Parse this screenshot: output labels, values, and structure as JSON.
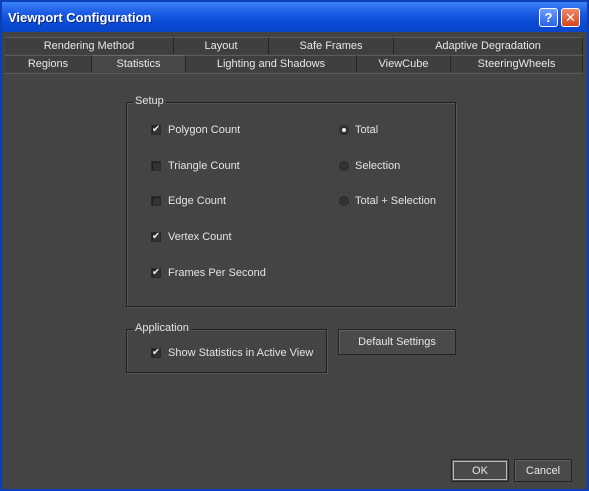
{
  "window": {
    "title": "Viewport Configuration",
    "help_glyph": "?",
    "close_glyph": "✕"
  },
  "tabs": {
    "row1": [
      "Rendering Method",
      "Layout",
      "Safe Frames",
      "Adaptive Degradation"
    ],
    "row2": [
      "Regions",
      "Statistics",
      "Lighting and Shadows",
      "ViewCube",
      "SteeringWheels"
    ],
    "active": "Statistics"
  },
  "setup": {
    "title": "Setup",
    "checkboxes": [
      {
        "label": "Polygon Count",
        "checked": true
      },
      {
        "label": "Triangle Count",
        "checked": false
      },
      {
        "label": "Edge Count",
        "checked": false
      },
      {
        "label": "Vertex Count",
        "checked": true
      },
      {
        "label": "Frames Per Second",
        "checked": true
      }
    ],
    "radios": [
      {
        "label": "Total",
        "selected": true
      },
      {
        "label": "Selection",
        "selected": false
      },
      {
        "label": "Total + Selection",
        "selected": false
      }
    ]
  },
  "application": {
    "title": "Application",
    "checkbox": {
      "label": "Show Statistics in Active View",
      "checked": true
    }
  },
  "buttons": {
    "default_settings": "Default Settings",
    "ok": "OK",
    "cancel": "Cancel"
  },
  "check_glyph": "✔"
}
